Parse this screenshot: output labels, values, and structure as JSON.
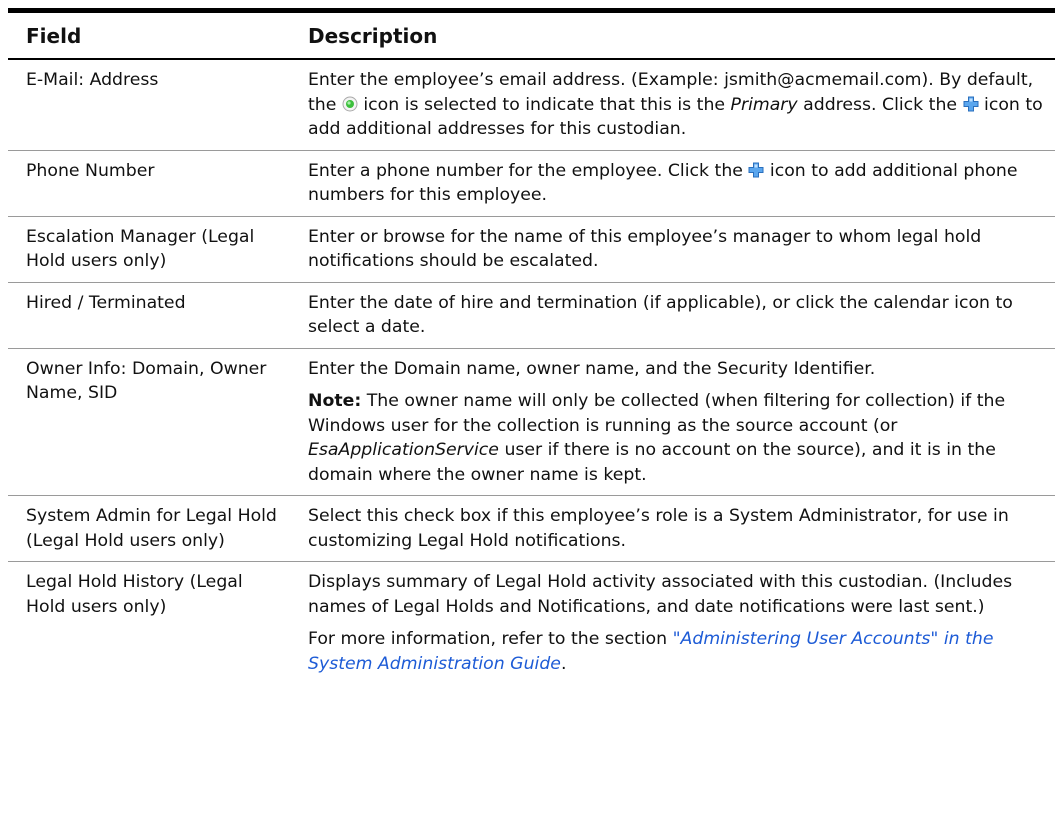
{
  "header": {
    "field": "Field",
    "description": "Description"
  },
  "rows": [
    {
      "field": "E-Mail: Address",
      "desc": {
        "t1": "Enter the employee’s email address. (Example: jsmith@acmemail.com). By default, the ",
        "t2": " icon is selected to indicate that this is the ",
        "em": "Primary",
        "t3": " address. Click the ",
        "t4": " icon to add additional addresses for this custodian."
      }
    },
    {
      "field": "Phone Number",
      "desc": {
        "t1": "Enter a phone number for the employee. Click the ",
        "t2": " icon to add additional phone numbers for this employee."
      }
    },
    {
      "field": "Escalation Manager (Legal Hold users only)",
      "desc": {
        "t1": "Enter or browse for the name of this employee’s manager to whom legal hold notifications should be escalated."
      }
    },
    {
      "field": "Hired / Terminated",
      "desc": {
        "t1": "Enter the date of hire and termination (if applicable), or click the calendar icon to select a date."
      }
    },
    {
      "field": "Owner Info: Domain, Owner Name, SID",
      "desc": {
        "p1": "Enter the Domain name, owner name, and the Security Identifier.",
        "note_label": "Note:",
        "n1": "  The owner name will only be collected (when filtering for collection) if the Windows user for the collection is running as the source account (or ",
        "em": "EsaApplicationService",
        "n2": " user if there is no account on the source), and it is in the domain where the owner name is kept."
      }
    },
    {
      "field_line1": "System Admin for Legal Hold",
      "field_line2": "(Legal Hold users only)",
      "desc": {
        "t1": "Select this check box if this employee’s role is a System Administrator, for use in customizing Legal Hold notifications."
      }
    },
    {
      "field": "Legal Hold History (Legal Hold users only)",
      "desc": {
        "p1": "Displays summary of Legal Hold activity associated with this custodian. (Includes names of Legal Holds and Notifications, and date notifications were last sent.)",
        "p2_prefix": "For more information, refer to the section ",
        "p2_link": "\"Administering User Accounts\" in the System Administration Guide",
        "p2_suffix": "."
      }
    }
  ],
  "icons": {
    "primary_radio": "radio-selected-icon",
    "add": "plus-icon"
  },
  "colors": {
    "link": "#1d5bd6",
    "radio_green": "#3cbf3c",
    "plus_blue": "#3a8fe0"
  }
}
